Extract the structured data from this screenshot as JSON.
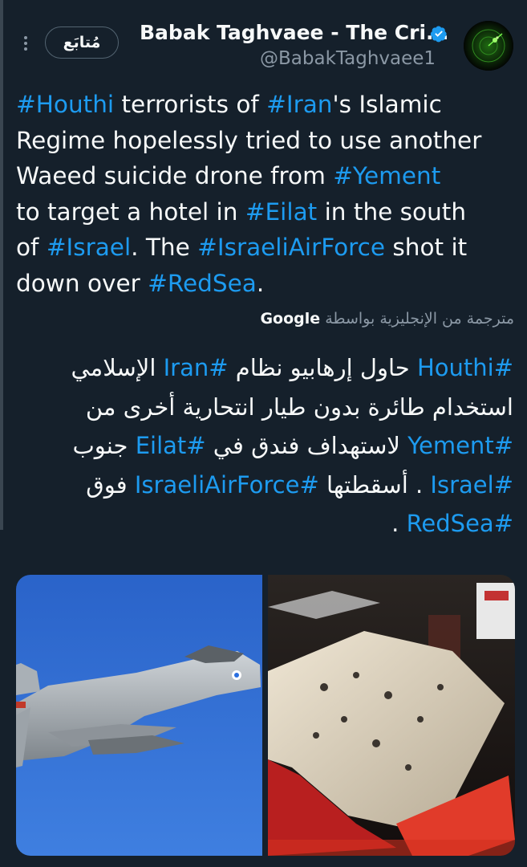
{
  "header": {
    "follow_label": "مُتابَع",
    "display_name": "Babak Taghvaee - The Cri...",
    "handle": "@BabakTaghvaee1"
  },
  "tweet": {
    "lines": [
      [
        {
          "t": "#Houthi",
          "h": true
        },
        {
          "t": " terrorists of ",
          "h": false
        },
        {
          "t": "#Iran",
          "h": true
        },
        {
          "t": "'s Islamic",
          "h": false
        }
      ],
      [
        {
          "t": "Regime hopelessly tried to use another",
          "h": false
        }
      ],
      [
        {
          "t": "Waeed suicide drone from ",
          "h": false
        },
        {
          "t": "#Yement",
          "h": true
        }
      ],
      [
        {
          "t": "to target a hotel in ",
          "h": false
        },
        {
          "t": "#Eilat",
          "h": true
        },
        {
          "t": " in the south",
          "h": false
        }
      ],
      [
        {
          "t": "of ",
          "h": false
        },
        {
          "t": "#Israel",
          "h": true
        },
        {
          "t": ". The ",
          "h": false
        },
        {
          "t": "#IsraeliAirForce",
          "h": true
        },
        {
          "t": " shot it",
          "h": false
        }
      ],
      [
        {
          "t": "down over ",
          "h": false
        },
        {
          "t": "#RedSea",
          "h": true
        },
        {
          "t": ".",
          "h": false
        }
      ]
    ]
  },
  "translation": {
    "label": "مترجمة من الإنجليزية بواسطة",
    "provider": "Google",
    "lines": [
      [
        {
          "t": "#Houthi",
          "h": true
        },
        {
          "t": " حاول إرهابيو نظام ",
          "h": false
        },
        {
          "t": "#Iran",
          "h": true
        },
        {
          "t": " الإسلامي",
          "h": false
        }
      ],
      [
        {
          "t": "استخدام طائرة بدون طيار انتحارية أخرى من",
          "h": false
        }
      ],
      [
        {
          "t": "#Yement",
          "h": true
        },
        {
          "t": " لاستهداف فندق في ",
          "h": false
        },
        {
          "t": "#Eilat",
          "h": true
        },
        {
          "t": " جنوب",
          "h": false
        }
      ],
      [
        {
          "t": "#Israel",
          "h": true
        },
        {
          "t": " . أسقطتها ",
          "h": false
        },
        {
          "t": "#IsraeliAirForce",
          "h": true
        },
        {
          "t": " فوق",
          "h": false
        }
      ],
      [
        {
          "t": "#RedSea",
          "h": true
        },
        {
          "t": " .",
          "h": false
        }
      ]
    ]
  },
  "colors": {
    "background": "#15202b",
    "text": "#f7f9f9",
    "secondary": "#8b98a5",
    "link": "#1d9bf0"
  },
  "icons": {
    "menu": "more-vertical-icon",
    "verified": "verified-badge-icon"
  }
}
